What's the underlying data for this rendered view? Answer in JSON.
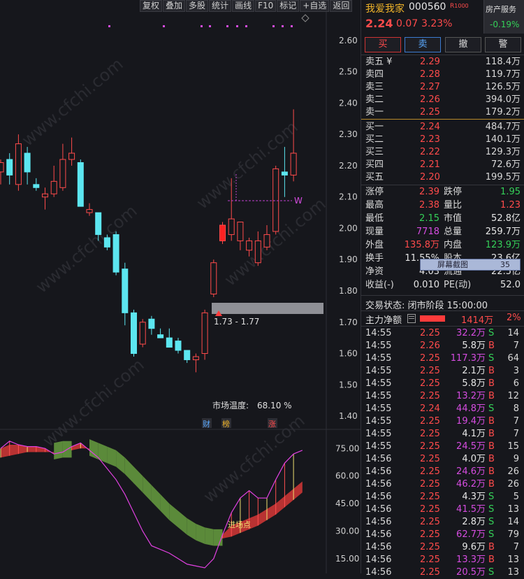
{
  "toolbar": [
    "复权",
    "叠加",
    "多股",
    "统计",
    "画线",
    "F10",
    "标记",
    "+自选",
    "返回"
  ],
  "stock": {
    "name": "我爱我家",
    "code": "000560",
    "badge": "R",
    "badge2": "1000",
    "price": "2.24",
    "change": "0.07",
    "pct": "3.23%",
    "sector": "房产服务",
    "sector_pct": "-0.19%"
  },
  "actions": [
    "买",
    "卖",
    "撤",
    "警"
  ],
  "sell": [
    {
      "label": "卖五 ¥",
      "price": "2.29",
      "vol": "118.4万"
    },
    {
      "label": "卖四",
      "price": "2.28",
      "vol": "119.7万"
    },
    {
      "label": "卖三",
      "price": "2.27",
      "vol": "126.5万"
    },
    {
      "label": "卖二",
      "price": "2.26",
      "vol": "394.0万"
    },
    {
      "label": "卖一",
      "price": "2.25",
      "vol": "179.2万"
    }
  ],
  "buy": [
    {
      "label": "买一",
      "price": "2.24",
      "vol": "484.7万"
    },
    {
      "label": "买二",
      "price": "2.23",
      "vol": "140.1万"
    },
    {
      "label": "买三",
      "price": "2.22",
      "vol": "129.3万"
    },
    {
      "label": "买四",
      "price": "2.21",
      "vol": "72.6万"
    },
    {
      "label": "买五",
      "price": "2.20",
      "vol": "199.5万"
    }
  ],
  "stats": [
    {
      "l1": "涨停",
      "v1": "2.39",
      "c1": "red",
      "l2": "跌停",
      "v2": "1.95",
      "c2": "green"
    },
    {
      "l1": "最高",
      "v1": "2.38",
      "c1": "red",
      "l2": "量比",
      "v2": "1.23",
      "c2": "red"
    },
    {
      "l1": "最低",
      "v1": "2.15",
      "c1": "green",
      "l2": "市值",
      "v2": "52.8亿",
      "c2": "white"
    },
    {
      "l1": "现量",
      "v1": "7718",
      "c1": "purple",
      "l2": "总量",
      "v2": "259.7万",
      "c2": "white"
    },
    {
      "l1": "外盘",
      "v1": "135.8万",
      "c1": "red",
      "l2": "内盘",
      "v2": "123.9万",
      "c2": "green"
    },
    {
      "l1": "换手",
      "v1": "11.55%",
      "c1": "white",
      "l2": "股本",
      "v2": "23.6亿",
      "c2": "white"
    },
    {
      "l1": "净资",
      "v1": "4.03",
      "c1": "white",
      "l2": "流通",
      "v2": "22.5亿",
      "c2": "white"
    },
    {
      "l1": "收益(-)",
      "v1": "0.010",
      "c1": "white",
      "l2": "PE(动)",
      "v2": "52.0",
      "c2": "white"
    }
  ],
  "screenshot_overlay": {
    "label": "屏幕截图",
    "value": "35"
  },
  "trade_status": "交易状态: 闭市阶段 15:00:00",
  "main_flow": {
    "label": "主力净额",
    "value": "1414万",
    "pct": "2%"
  },
  "ticks": [
    {
      "t": "14:55",
      "p": "2.25",
      "v": "32.2万",
      "vc": "purple",
      "s": "S",
      "n": "14"
    },
    {
      "t": "14:55",
      "p": "2.26",
      "v": "5.8万",
      "vc": "white",
      "s": "B",
      "n": "7"
    },
    {
      "t": "14:55",
      "p": "2.25",
      "v": "117.3万",
      "vc": "purple",
      "s": "S",
      "n": "64"
    },
    {
      "t": "14:55",
      "p": "2.25",
      "v": "2.1万",
      "vc": "white",
      "s": "B",
      "n": "3"
    },
    {
      "t": "14:55",
      "p": "2.25",
      "v": "5.8万",
      "vc": "white",
      "s": "B",
      "n": "6"
    },
    {
      "t": "14:55",
      "p": "2.25",
      "v": "13.2万",
      "vc": "purple",
      "s": "B",
      "n": "12"
    },
    {
      "t": "14:55",
      "p": "2.24",
      "v": "44.8万",
      "vc": "purple",
      "s": "S",
      "n": "8"
    },
    {
      "t": "14:55",
      "p": "2.25",
      "v": "19.4万",
      "vc": "purple",
      "s": "B",
      "n": "7"
    },
    {
      "t": "14:55",
      "p": "2.25",
      "v": "4.1万",
      "vc": "white",
      "s": "B",
      "n": "7"
    },
    {
      "t": "14:55",
      "p": "2.25",
      "v": "24.5万",
      "vc": "purple",
      "s": "B",
      "n": "15"
    },
    {
      "t": "14:56",
      "p": "2.25",
      "v": "4.0万",
      "vc": "white",
      "s": "B",
      "n": "9"
    },
    {
      "t": "14:56",
      "p": "2.25",
      "v": "24.6万",
      "vc": "purple",
      "s": "B",
      "n": "26"
    },
    {
      "t": "14:56",
      "p": "2.25",
      "v": "46.2万",
      "vc": "purple",
      "s": "B",
      "n": "26"
    },
    {
      "t": "14:56",
      "p": "2.25",
      "v": "4.3万",
      "vc": "white",
      "s": "S",
      "n": "5"
    },
    {
      "t": "14:56",
      "p": "2.25",
      "v": "41.5万",
      "vc": "purple",
      "s": "S",
      "n": "13"
    },
    {
      "t": "14:56",
      "p": "2.25",
      "v": "2.8万",
      "vc": "white",
      "s": "S",
      "n": "14"
    },
    {
      "t": "14:56",
      "p": "2.25",
      "v": "62.7万",
      "vc": "purple",
      "s": "S",
      "n": "79"
    },
    {
      "t": "14:56",
      "p": "2.25",
      "v": "9.6万",
      "vc": "white",
      "s": "B",
      "n": "7"
    },
    {
      "t": "14:56",
      "p": "2.25",
      "v": "13.3万",
      "vc": "purple",
      "s": "B",
      "n": "13"
    },
    {
      "t": "14:56",
      "p": "2.25",
      "v": "20.5万",
      "vc": "purple",
      "s": "S",
      "n": "13"
    }
  ],
  "chart_data": [
    {
      "type": "candlestick",
      "y_ticks": [
        "2.60",
        "2.50",
        "2.40",
        "2.30",
        "2.20",
        "2.10",
        "2.00",
        "1.90",
        "1.80",
        "1.70",
        "1.60",
        "1.50",
        "1.40"
      ],
      "ylim": [
        1.38,
        2.64
      ],
      "candles": [
        {
          "o": 2.18,
          "h": 2.22,
          "l": 2.14,
          "c": 2.21
        },
        {
          "o": 2.22,
          "h": 2.24,
          "l": 2.14,
          "c": 2.17
        },
        {
          "o": 2.14,
          "h": 2.3,
          "l": 2.12,
          "c": 2.27
        },
        {
          "o": 2.24,
          "h": 2.26,
          "l": 2.14,
          "c": 2.18
        },
        {
          "o": 2.14,
          "h": 2.16,
          "l": 2.12,
          "c": 2.13
        },
        {
          "o": 2.1,
          "h": 2.13,
          "l": 2.06,
          "c": 2.11
        },
        {
          "o": 2.11,
          "h": 2.2,
          "l": 2.1,
          "c": 2.15
        },
        {
          "o": 2.13,
          "h": 2.27,
          "l": 2.12,
          "c": 2.22
        },
        {
          "o": 2.22,
          "h": 2.29,
          "l": 2.2,
          "c": 2.24
        },
        {
          "o": 2.21,
          "h": 2.22,
          "l": 2.07,
          "c": 2.07
        },
        {
          "o": 2.05,
          "h": 2.08,
          "l": 2.04,
          "c": 2.06
        },
        {
          "o": 2.05,
          "h": 2.05,
          "l": 1.96,
          "c": 1.98
        },
        {
          "o": 1.97,
          "h": 1.98,
          "l": 1.93,
          "c": 1.94
        },
        {
          "o": 1.98,
          "h": 1.99,
          "l": 1.85,
          "c": 1.86
        },
        {
          "o": 1.87,
          "h": 1.89,
          "l": 1.69,
          "c": 1.73
        },
        {
          "o": 1.73,
          "h": 1.74,
          "l": 1.59,
          "c": 1.6
        },
        {
          "o": 1.63,
          "h": 1.71,
          "l": 1.62,
          "c": 1.7
        },
        {
          "o": 1.71,
          "h": 1.72,
          "l": 1.66,
          "c": 1.68
        },
        {
          "o": 1.66,
          "h": 1.68,
          "l": 1.65,
          "c": 1.65
        },
        {
          "o": 1.65,
          "h": 1.68,
          "l": 1.62,
          "c": 1.62
        },
        {
          "o": 1.64,
          "h": 1.65,
          "l": 1.6,
          "c": 1.61
        },
        {
          "o": 1.61,
          "h": 1.61,
          "l": 1.57,
          "c": 1.58
        },
        {
          "o": 1.58,
          "h": 1.6,
          "l": 1.54,
          "c": 1.59
        },
        {
          "o": 1.6,
          "h": 1.74,
          "l": 1.58,
          "c": 1.73
        },
        {
          "o": 1.79,
          "h": 1.9,
          "l": 1.78,
          "c": 1.89
        },
        {
          "o": 1.96,
          "h": 2.02,
          "l": 1.95,
          "c": 2.01
        },
        {
          "o": 1.98,
          "h": 2.16,
          "l": 1.96,
          "c": 2.03
        },
        {
          "o": 1.96,
          "h": 2.02,
          "l": 1.93,
          "c": 2.02
        },
        {
          "o": 1.93,
          "h": 1.97,
          "l": 1.91,
          "c": 1.96
        },
        {
          "o": 1.89,
          "h": 1.99,
          "l": 1.88,
          "c": 1.96
        },
        {
          "o": 1.94,
          "h": 2.01,
          "l": 1.93,
          "c": 1.98
        },
        {
          "o": 1.99,
          "h": 2.2,
          "l": 1.98,
          "c": 2.19
        },
        {
          "o": 2.18,
          "h": 2.26,
          "l": 2.1,
          "c": 2.17
        },
        {
          "o": 2.17,
          "h": 2.38,
          "l": 2.15,
          "c": 2.24
        }
      ],
      "annotations": [
        "W",
        "1.73 - 1.77",
        "市场温度:",
        "68.10 %"
      ],
      "markers": [
        "财",
        "榜",
        "涨"
      ]
    },
    {
      "type": "line",
      "y_ticks": [
        "75.00",
        "60.00",
        "45.00",
        "30.00",
        "15.00"
      ],
      "ylim": [
        10,
        85
      ],
      "series": [
        {
          "values": [
            75,
            79,
            77,
            76,
            76,
            75,
            72,
            73,
            76,
            78,
            74,
            70,
            64,
            58,
            50,
            40,
            30,
            22,
            20,
            18,
            15,
            12,
            11,
            10,
            15,
            28,
            40,
            48,
            52,
            48,
            48,
            58,
            67,
            72,
            74
          ]
        },
        {
          "values": [
            70,
            71,
            72,
            73,
            73,
            73,
            73,
            74,
            74,
            75,
            75,
            73,
            71,
            69,
            65,
            60,
            55,
            50,
            45,
            40,
            36,
            32,
            29,
            27,
            26,
            26,
            27,
            29,
            31,
            33,
            36,
            39,
            43,
            47,
            51
          ]
        }
      ],
      "annotations": [
        "进场点"
      ]
    }
  ]
}
